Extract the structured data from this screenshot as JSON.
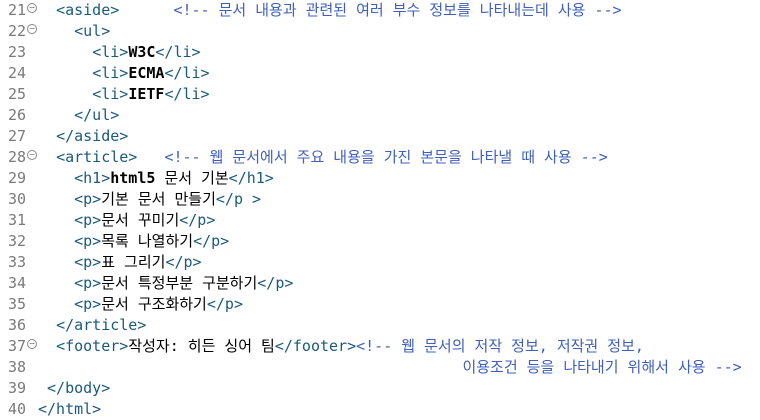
{
  "editor": {
    "fold_icon": "minus-circle",
    "lines": [
      {
        "no": "21",
        "fold": true,
        "indent": "  ",
        "segments": [
          {
            "t": "tag",
            "v": "<aside>"
          },
          {
            "t": "txt",
            "v": "      "
          },
          {
            "t": "cmt",
            "v": "<!-- 문서 내용과 관련된 여러 부수 정보를 나타내는데 사용 -->"
          }
        ]
      },
      {
        "no": "22",
        "fold": true,
        "indent": "    ",
        "segments": [
          {
            "t": "tag",
            "v": "<ul>"
          }
        ]
      },
      {
        "no": "23",
        "fold": false,
        "indent": "      ",
        "segments": [
          {
            "t": "tag",
            "v": "<li>"
          },
          {
            "t": "bold",
            "v": "W3C"
          },
          {
            "t": "tag",
            "v": "</li>"
          }
        ]
      },
      {
        "no": "24",
        "fold": false,
        "indent": "      ",
        "segments": [
          {
            "t": "tag",
            "v": "<li>"
          },
          {
            "t": "bold",
            "v": "ECMA"
          },
          {
            "t": "tag",
            "v": "</li>"
          }
        ]
      },
      {
        "no": "25",
        "fold": false,
        "indent": "      ",
        "segments": [
          {
            "t": "tag",
            "v": "<li>"
          },
          {
            "t": "bold",
            "v": "IETF"
          },
          {
            "t": "tag",
            "v": "</li>"
          }
        ]
      },
      {
        "no": "26",
        "fold": false,
        "indent": "    ",
        "segments": [
          {
            "t": "tag",
            "v": "</ul>"
          }
        ]
      },
      {
        "no": "27",
        "fold": false,
        "indent": "  ",
        "segments": [
          {
            "t": "tag",
            "v": "</aside>"
          }
        ]
      },
      {
        "no": "28",
        "fold": true,
        "indent": "  ",
        "segments": [
          {
            "t": "tag",
            "v": "<article>"
          },
          {
            "t": "txt",
            "v": "   "
          },
          {
            "t": "cmt",
            "v": "<!-- 웹 문서에서 주요 내용을 가진 본문을 나타낼 때 사용 -->"
          }
        ]
      },
      {
        "no": "29",
        "fold": false,
        "indent": "    ",
        "segments": [
          {
            "t": "tag",
            "v": "<h1>"
          },
          {
            "t": "bold",
            "v": "html5"
          },
          {
            "t": "txt",
            "v": " 문서 기본"
          },
          {
            "t": "tag",
            "v": "</h1>"
          }
        ]
      },
      {
        "no": "30",
        "fold": false,
        "indent": "    ",
        "segments": [
          {
            "t": "tag",
            "v": "<p>"
          },
          {
            "t": "txt",
            "v": "기본 문서 만들기"
          },
          {
            "t": "tag",
            "v": "</p >"
          }
        ]
      },
      {
        "no": "31",
        "fold": false,
        "indent": "    ",
        "segments": [
          {
            "t": "tag",
            "v": "<p>"
          },
          {
            "t": "txt",
            "v": "문서 꾸미기"
          },
          {
            "t": "tag",
            "v": "</p>"
          }
        ]
      },
      {
        "no": "32",
        "fold": false,
        "indent": "    ",
        "segments": [
          {
            "t": "tag",
            "v": "<p>"
          },
          {
            "t": "txt",
            "v": "목록 나열하기"
          },
          {
            "t": "tag",
            "v": "</p>"
          }
        ]
      },
      {
        "no": "33",
        "fold": false,
        "indent": "    ",
        "segments": [
          {
            "t": "tag",
            "v": "<p>"
          },
          {
            "t": "txt",
            "v": "표 그리기"
          },
          {
            "t": "tag",
            "v": "</p>"
          }
        ]
      },
      {
        "no": "34",
        "fold": false,
        "indent": "    ",
        "segments": [
          {
            "t": "tag",
            "v": "<p>"
          },
          {
            "t": "txt",
            "v": "문서 특정부분 구분하기"
          },
          {
            "t": "tag",
            "v": "</p>"
          }
        ]
      },
      {
        "no": "35",
        "fold": false,
        "indent": "    ",
        "segments": [
          {
            "t": "tag",
            "v": "<p>"
          },
          {
            "t": "txt",
            "v": "문서 구조화하기"
          },
          {
            "t": "tag",
            "v": "</p>"
          }
        ]
      },
      {
        "no": "36",
        "fold": false,
        "indent": "  ",
        "segments": [
          {
            "t": "tag",
            "v": "</article>"
          }
        ]
      },
      {
        "no": "37",
        "fold": true,
        "indent": "  ",
        "segments": [
          {
            "t": "tag",
            "v": "<footer>"
          },
          {
            "t": "txt",
            "v": "작성자: 히든 싱어 팀"
          },
          {
            "t": "tag",
            "v": "</footer>"
          },
          {
            "t": "cmt",
            "v": "<!-- 웹 문서의 저작 정보, 저작권 정보,"
          }
        ]
      },
      {
        "no": "38",
        "fold": false,
        "indent": "                                               ",
        "segments": [
          {
            "t": "cmt",
            "v": "이용조건 등을 나타내기 위해서 사용 -->"
          }
        ]
      },
      {
        "no": "39",
        "fold": false,
        "indent": " ",
        "segments": [
          {
            "t": "tag",
            "v": "</body>"
          }
        ]
      },
      {
        "no": "40",
        "fold": false,
        "indent": "",
        "segments": [
          {
            "t": "tag",
            "v": "</html>"
          }
        ]
      }
    ]
  }
}
